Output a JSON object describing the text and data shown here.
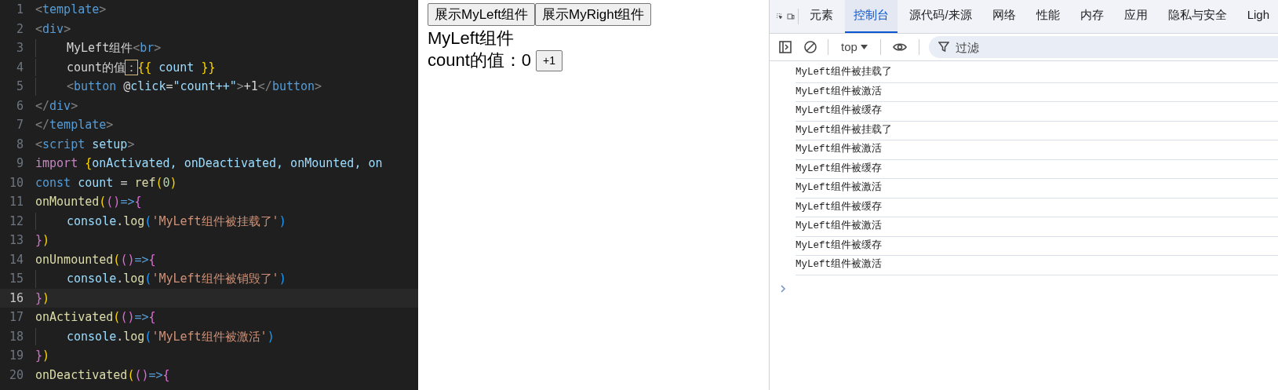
{
  "editor": {
    "lines": [
      {
        "number": "1",
        "current": false,
        "tokens": [
          {
            "kind": "punct",
            "text": "<"
          },
          {
            "kind": "tag",
            "text": "template"
          },
          {
            "kind": "punct",
            "text": ">"
          }
        ]
      },
      {
        "number": "2",
        "current": false,
        "tokens": [
          {
            "kind": "punct",
            "text": "<"
          },
          {
            "kind": "tag",
            "text": "div"
          },
          {
            "kind": "punct",
            "text": ">"
          }
        ]
      },
      {
        "number": "3",
        "current": false,
        "indent": true,
        "tokens": [
          {
            "kind": "plain",
            "text": "MyLeft组件"
          },
          {
            "kind": "punct",
            "text": "<"
          },
          {
            "kind": "tag",
            "text": "br"
          },
          {
            "kind": "punct",
            "text": ">"
          }
        ]
      },
      {
        "number": "4",
        "current": false,
        "indent": true,
        "tokens": [
          {
            "kind": "plain",
            "text": "count的值"
          },
          {
            "kind": "highlight",
            "text": "："
          },
          {
            "kind": "brace",
            "text": "{{"
          },
          {
            "kind": "var",
            "text": " count "
          },
          {
            "kind": "brace",
            "text": "}}"
          }
        ]
      },
      {
        "number": "5",
        "current": false,
        "indent": true,
        "tokens": [
          {
            "kind": "punct",
            "text": "<"
          },
          {
            "kind": "tag",
            "text": "button"
          },
          {
            "kind": "plain",
            "text": " @"
          },
          {
            "kind": "var",
            "text": "click"
          },
          {
            "kind": "plain",
            "text": "="
          },
          {
            "kind": "var",
            "text": "\"count++\""
          },
          {
            "kind": "punct",
            "text": ">"
          },
          {
            "kind": "plain",
            "text": "+1"
          },
          {
            "kind": "punct",
            "text": "</"
          },
          {
            "kind": "tag",
            "text": "button"
          },
          {
            "kind": "punct",
            "text": ">"
          }
        ]
      },
      {
        "number": "6",
        "current": false,
        "tokens": [
          {
            "kind": "punct",
            "text": "</"
          },
          {
            "kind": "tag",
            "text": "div"
          },
          {
            "kind": "punct",
            "text": ">"
          }
        ]
      },
      {
        "number": "7",
        "current": false,
        "tokens": [
          {
            "kind": "punct",
            "text": "</"
          },
          {
            "kind": "tag",
            "text": "template"
          },
          {
            "kind": "punct",
            "text": ">"
          }
        ]
      },
      {
        "number": "8",
        "current": false,
        "tokens": [
          {
            "kind": "punct",
            "text": "<"
          },
          {
            "kind": "tag",
            "text": "script"
          },
          {
            "kind": "var",
            "text": " setup"
          },
          {
            "kind": "punct",
            "text": ">"
          }
        ]
      },
      {
        "number": "9",
        "current": false,
        "tokens": [
          {
            "kind": "keyword",
            "text": "import "
          },
          {
            "kind": "brace",
            "text": "{"
          },
          {
            "kind": "var",
            "text": "onActivated, onDeactivated, onMounted, on"
          }
        ]
      },
      {
        "number": "10",
        "current": false,
        "tokens": [
          {
            "kind": "tag",
            "text": "const "
          },
          {
            "kind": "var",
            "text": "count "
          },
          {
            "kind": "plain",
            "text": "= "
          },
          {
            "kind": "func",
            "text": "ref"
          },
          {
            "kind": "brace",
            "text": "("
          },
          {
            "kind": "number",
            "text": "0"
          },
          {
            "kind": "brace",
            "text": ")"
          }
        ]
      },
      {
        "number": "11",
        "current": false,
        "tokens": [
          {
            "kind": "func",
            "text": "onMounted"
          },
          {
            "kind": "brace",
            "text": "("
          },
          {
            "kind": "paren",
            "text": "()"
          },
          {
            "kind": "tag",
            "text": "=>"
          },
          {
            "kind": "paren",
            "text": "{"
          }
        ]
      },
      {
        "number": "12",
        "current": false,
        "indent": true,
        "tokens": [
          {
            "kind": "var",
            "text": "console"
          },
          {
            "kind": "plain",
            "text": "."
          },
          {
            "kind": "func",
            "text": "log"
          },
          {
            "kind": "inner",
            "text": "("
          },
          {
            "kind": "string",
            "text": "'MyLeft组件被挂载了'"
          },
          {
            "kind": "inner",
            "text": ")"
          }
        ]
      },
      {
        "number": "13",
        "current": false,
        "tokens": [
          {
            "kind": "paren",
            "text": "}"
          },
          {
            "kind": "brace",
            "text": ")"
          }
        ]
      },
      {
        "number": "14",
        "current": false,
        "tokens": [
          {
            "kind": "func",
            "text": "onUnmounted"
          },
          {
            "kind": "brace",
            "text": "("
          },
          {
            "kind": "paren",
            "text": "()"
          },
          {
            "kind": "tag",
            "text": "=>"
          },
          {
            "kind": "paren",
            "text": "{"
          }
        ]
      },
      {
        "number": "15",
        "current": false,
        "indent": true,
        "tokens": [
          {
            "kind": "var",
            "text": "console"
          },
          {
            "kind": "plain",
            "text": "."
          },
          {
            "kind": "func",
            "text": "log"
          },
          {
            "kind": "inner",
            "text": "("
          },
          {
            "kind": "string",
            "text": "'MyLeft组件被销毁了'"
          },
          {
            "kind": "inner",
            "text": ")"
          }
        ]
      },
      {
        "number": "16",
        "current": true,
        "tokens": [
          {
            "kind": "paren",
            "text": "}"
          },
          {
            "kind": "brace",
            "text": ")"
          }
        ]
      },
      {
        "number": "17",
        "current": false,
        "tokens": [
          {
            "kind": "func",
            "text": "onActivated"
          },
          {
            "kind": "brace",
            "text": "("
          },
          {
            "kind": "paren",
            "text": "()"
          },
          {
            "kind": "tag",
            "text": "=>"
          },
          {
            "kind": "paren",
            "text": "{"
          }
        ]
      },
      {
        "number": "18",
        "current": false,
        "indent": true,
        "tokens": [
          {
            "kind": "var",
            "text": "console"
          },
          {
            "kind": "plain",
            "text": "."
          },
          {
            "kind": "func",
            "text": "log"
          },
          {
            "kind": "inner",
            "text": "("
          },
          {
            "kind": "string",
            "text": "'MyLeft组件被激活'"
          },
          {
            "kind": "inner",
            "text": ")"
          }
        ]
      },
      {
        "number": "19",
        "current": false,
        "tokens": [
          {
            "kind": "paren",
            "text": "}"
          },
          {
            "kind": "brace",
            "text": ")"
          }
        ]
      },
      {
        "number": "20",
        "current": false,
        "tokens": [
          {
            "kind": "func",
            "text": "onDeactivated"
          },
          {
            "kind": "brace",
            "text": "("
          },
          {
            "kind": "paren",
            "text": "()"
          },
          {
            "kind": "tag",
            "text": "=>"
          },
          {
            "kind": "paren",
            "text": "{"
          }
        ]
      }
    ]
  },
  "preview": {
    "buttons": [
      "展示MyLeft组件",
      "展示MyRight组件"
    ],
    "heading": "MyLeft组件",
    "count_label": "count的值：0",
    "increment_button": "+1"
  },
  "devtools": {
    "tabs": [
      {
        "label": "元素",
        "selected": false
      },
      {
        "label": "控制台",
        "selected": true
      },
      {
        "label": "源代码/来源",
        "selected": false
      },
      {
        "label": "网络",
        "selected": false
      },
      {
        "label": "性能",
        "selected": false
      },
      {
        "label": "内存",
        "selected": false
      },
      {
        "label": "应用",
        "selected": false
      },
      {
        "label": "隐私与安全",
        "selected": false
      },
      {
        "label": "Ligh",
        "selected": false
      }
    ],
    "context": "top",
    "filter": {
      "placeholder": "过滤"
    },
    "messages": [
      "MyLeft组件被挂载了",
      "MyLeft组件被激活",
      "MyLeft组件被缓存",
      "MyLeft组件被挂载了",
      "MyLeft组件被激活",
      "MyLeft组件被缓存",
      "MyLeft组件被激活",
      "MyLeft组件被缓存",
      "MyLeft组件被激活",
      "MyLeft组件被缓存",
      "MyLeft组件被激活"
    ]
  }
}
